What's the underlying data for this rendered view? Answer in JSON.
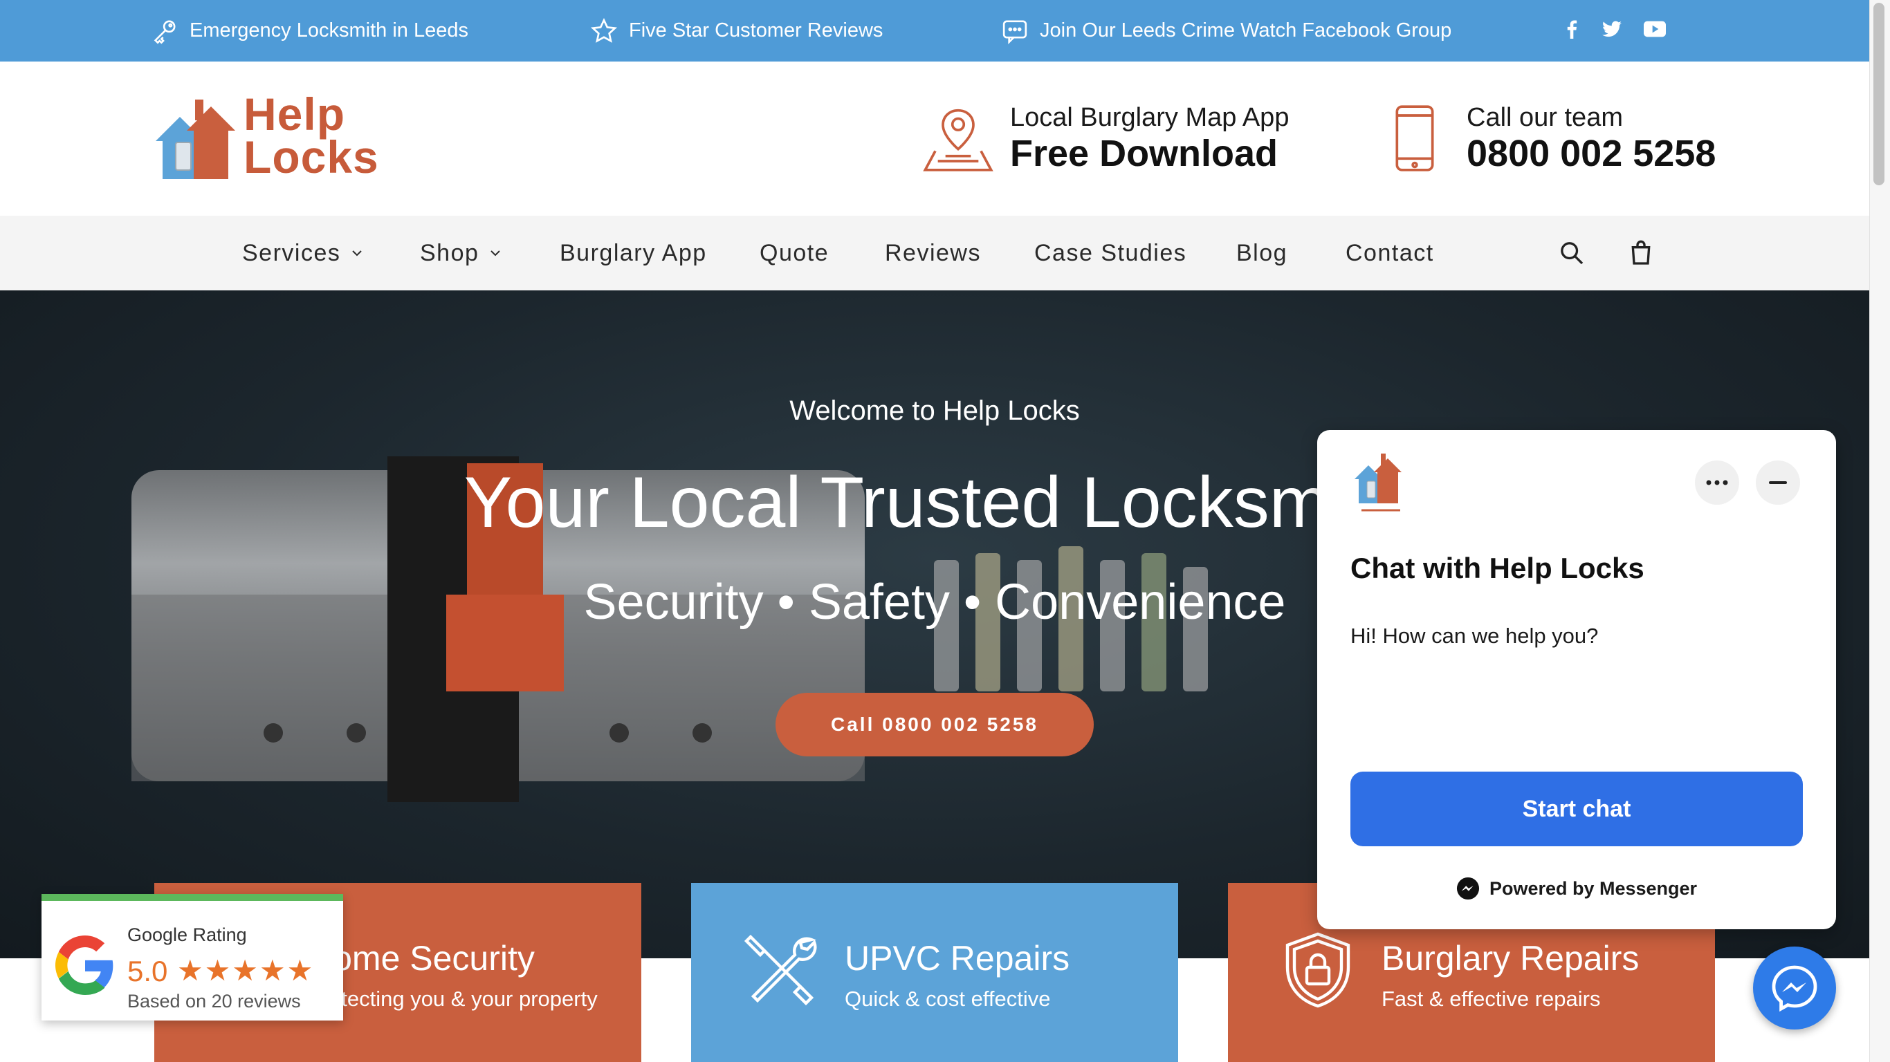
{
  "topbar": {
    "emergency": "Emergency Locksmith in Leeds",
    "reviews": "Five Star Customer Reviews",
    "facebook_group": "Join Our Leeds Crime Watch Facebook Group",
    "social_icons": [
      "facebook-icon",
      "twitter-icon",
      "youtube-icon"
    ]
  },
  "header": {
    "logo_line1": "Help",
    "logo_line2": "Locks",
    "app_small": "Local Burglary Map App",
    "app_big": "Free Download",
    "call_small": "Call our team",
    "call_big": "0800 002 5258"
  },
  "nav": {
    "items": [
      "Services",
      "Shop",
      "Burglary App",
      "Quote",
      "Reviews",
      "Case Studies",
      "Blog",
      "Contact"
    ]
  },
  "hero": {
    "welcome": "Welcome to Help Locks",
    "title": "Your Local Trusted Locksmith",
    "subtitle": "Security • Safety • Convenience",
    "cta": "Call 0800 002 5258"
  },
  "cards": [
    {
      "title": "Home Security",
      "subtitle": "Protecting you & your property"
    },
    {
      "title": "UPVC Repairs",
      "subtitle": "Quick & cost effective"
    },
    {
      "title": "Burglary Repairs",
      "subtitle": "Fast & effective repairs"
    }
  ],
  "google_rating": {
    "label": "Google Rating",
    "score": "5.0",
    "stars": "★★★★★",
    "based_on": "Based on 20 reviews",
    "rating_value": 5
  },
  "chat": {
    "title": "Chat with Help Locks",
    "message": "Hi! How can we help you?",
    "start_button": "Start chat",
    "powered_by": "Powered by Messenger"
  },
  "colors": {
    "topbar_blue": "#4f9bd7",
    "brand_orange": "#c95f3e",
    "card_blue": "#5ca3d8",
    "messenger_blue": "#2f6fe5",
    "star_orange": "#e8732a"
  }
}
